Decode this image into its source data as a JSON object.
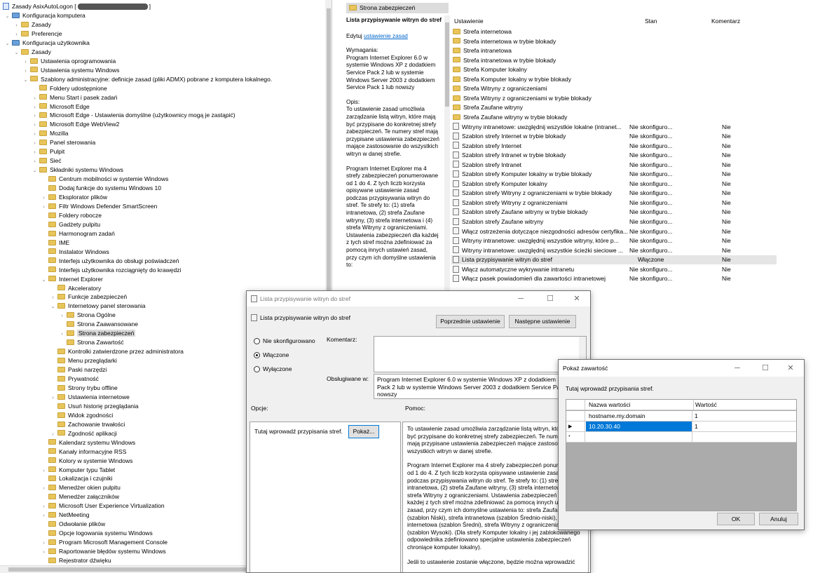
{
  "tree": {
    "root_label": "Zasady AsixAutoLogon [",
    "items": [
      {
        "label": "Konfiguracja komputera",
        "level": 0,
        "exp": "v",
        "icon": "computer"
      },
      {
        "label": "Zasady",
        "level": 1,
        "exp": ">",
        "icon": "folder"
      },
      {
        "label": "Preferencje",
        "level": 1,
        "exp": ">",
        "icon": "folder"
      },
      {
        "label": "Konfiguracja użytkownika",
        "level": 0,
        "exp": "v",
        "icon": "user"
      },
      {
        "label": "Zasady",
        "level": 1,
        "exp": "v",
        "icon": "folder"
      },
      {
        "label": "Ustawienia oprogramowania",
        "level": 2,
        "exp": ">",
        "icon": "folder"
      },
      {
        "label": "Ustawienia systemu Windows",
        "level": 2,
        "exp": ">",
        "icon": "folder"
      },
      {
        "label": "Szablony administracyjne: definicje zasad (pliki ADMX) pobrane z komputera lokalnego.",
        "level": 2,
        "exp": "v",
        "icon": "folder"
      },
      {
        "label": "Foldery udostępnione",
        "level": 3,
        "exp": "",
        "icon": "folder"
      },
      {
        "label": "Menu Start i pasek zadań",
        "level": 3,
        "exp": ">",
        "icon": "folder"
      },
      {
        "label": "Microsoft Edge",
        "level": 3,
        "exp": ">",
        "icon": "folder"
      },
      {
        "label": "Microsoft Edge - Ustawienia domyślne (użytkownicy mogą je zastąpić)",
        "level": 3,
        "exp": ">",
        "icon": "folder"
      },
      {
        "label": "Microsoft Edge WebView2",
        "level": 3,
        "exp": ">",
        "icon": "folder"
      },
      {
        "label": "Mozilla",
        "level": 3,
        "exp": ">",
        "icon": "folder"
      },
      {
        "label": "Panel sterowania",
        "level": 3,
        "exp": ">",
        "icon": "folder"
      },
      {
        "label": "Pulpit",
        "level": 3,
        "exp": ">",
        "icon": "folder"
      },
      {
        "label": "Sieć",
        "level": 3,
        "exp": ">",
        "icon": "folder"
      },
      {
        "label": "Składniki systemu Windows",
        "level": 3,
        "exp": "v",
        "icon": "folder"
      },
      {
        "label": "Centrum mobilności w systemie Windows",
        "level": 4,
        "exp": "",
        "icon": "folder"
      },
      {
        "label": "Dodaj funkcje do systemu Windows 10",
        "level": 4,
        "exp": "",
        "icon": "folder"
      },
      {
        "label": "Eksplorator plików",
        "level": 4,
        "exp": ">",
        "icon": "folder"
      },
      {
        "label": "Filtr Windows Defender SmartScreen",
        "level": 4,
        "exp": ">",
        "icon": "folder"
      },
      {
        "label": "Foldery robocze",
        "level": 4,
        "exp": "",
        "icon": "folder"
      },
      {
        "label": "Gadżety pulpitu",
        "level": 4,
        "exp": "",
        "icon": "folder"
      },
      {
        "label": "Harmonogram zadań",
        "level": 4,
        "exp": "",
        "icon": "folder"
      },
      {
        "label": "IME",
        "level": 4,
        "exp": "",
        "icon": "folder"
      },
      {
        "label": "Instalator Windows",
        "level": 4,
        "exp": "",
        "icon": "folder"
      },
      {
        "label": "Interfejs użytkownika do obsługi poświadczeń",
        "level": 4,
        "exp": "",
        "icon": "folder"
      },
      {
        "label": "Interfejs użytkownika rozciągnięty do krawędzi",
        "level": 4,
        "exp": "",
        "icon": "folder"
      },
      {
        "label": "Internet Explorer",
        "level": 4,
        "exp": "v",
        "icon": "folder"
      },
      {
        "label": "Akceleratory",
        "level": 5,
        "exp": "",
        "icon": "folder"
      },
      {
        "label": "Funkcje zabezpieczeń",
        "level": 5,
        "exp": ">",
        "icon": "folder"
      },
      {
        "label": "Internetowy panel sterowania",
        "level": 5,
        "exp": "v",
        "icon": "folder"
      },
      {
        "label": "Strona Ogólne",
        "level": 6,
        "exp": ">",
        "icon": "folder"
      },
      {
        "label": "Strona Zaawansowane",
        "level": 6,
        "exp": "",
        "icon": "folder"
      },
      {
        "label": "Strona zabezpieczeń",
        "level": 6,
        "exp": ">",
        "icon": "folder",
        "selected": true
      },
      {
        "label": "Strona Zawartość",
        "level": 6,
        "exp": "",
        "icon": "folder"
      },
      {
        "label": "Kontrolki zatwierdzone przez administratora",
        "level": 5,
        "exp": "",
        "icon": "folder"
      },
      {
        "label": "Menu przeglądarki",
        "level": 5,
        "exp": "",
        "icon": "folder"
      },
      {
        "label": "Paski narzędzi",
        "level": 5,
        "exp": "",
        "icon": "folder"
      },
      {
        "label": "Prywatność",
        "level": 5,
        "exp": "",
        "icon": "folder"
      },
      {
        "label": "Strony trybu offline",
        "level": 5,
        "exp": "",
        "icon": "folder"
      },
      {
        "label": "Ustawienia internetowe",
        "level": 5,
        "exp": ">",
        "icon": "folder"
      },
      {
        "label": "Usuń historię przeglądania",
        "level": 5,
        "exp": "",
        "icon": "folder"
      },
      {
        "label": "Widok zgodności",
        "level": 5,
        "exp": "",
        "icon": "folder"
      },
      {
        "label": "Zachowanie trwałości",
        "level": 5,
        "exp": "",
        "icon": "folder"
      },
      {
        "label": "Zgodność aplikacji",
        "level": 5,
        "exp": ">",
        "icon": "folder"
      },
      {
        "label": "Kalendarz systemu Windows",
        "level": 4,
        "exp": "",
        "icon": "folder"
      },
      {
        "label": "Kanały informacyjne RSS",
        "level": 4,
        "exp": "",
        "icon": "folder"
      },
      {
        "label": "Kolory w systemie Windows",
        "level": 4,
        "exp": "",
        "icon": "folder"
      },
      {
        "label": "Komputer typu Tablet",
        "level": 4,
        "exp": ">",
        "icon": "folder"
      },
      {
        "label": "Lokalizacja i czujniki",
        "level": 4,
        "exp": "",
        "icon": "folder"
      },
      {
        "label": "Menedżer okien pulpitu",
        "level": 4,
        "exp": ">",
        "icon": "folder"
      },
      {
        "label": "Menedżer załączników",
        "level": 4,
        "exp": "",
        "icon": "folder"
      },
      {
        "label": "Microsoft User Experience Virtualization",
        "level": 4,
        "exp": ">",
        "icon": "folder"
      },
      {
        "label": "NetMeeting",
        "level": 4,
        "exp": ">",
        "icon": "folder"
      },
      {
        "label": "Odwołanie plików",
        "level": 4,
        "exp": "",
        "icon": "folder"
      },
      {
        "label": "Opcje logowania systemu Windows",
        "level": 4,
        "exp": "",
        "icon": "folder"
      },
      {
        "label": "Program Microsoft Management Console",
        "level": 4,
        "exp": ">",
        "icon": "folder"
      },
      {
        "label": "Raportowanie błędów systemu Windows",
        "level": 4,
        "exp": ">",
        "icon": "folder"
      },
      {
        "label": "Rejestrator dźwięku",
        "level": 4,
        "exp": "",
        "icon": "folder"
      }
    ]
  },
  "detail": {
    "header": "Strona zabezpieczeń",
    "policy_title": "Lista przypisywanie witryn do stref",
    "edit_prefix": "Edytuj",
    "edit_link": "ustawienie zasad",
    "requirements_label": "Wymagania:",
    "requirements": "Program Internet Explorer 6.0 w systemie Windows XP z dodatkiem Service Pack 2 lub w systemie Windows Server 2003 z dodatkiem Service Pack 1 lub nowszy",
    "desc_label": "Opis:",
    "desc1": "To ustawienie zasad umożliwia zarządzanie listą witryn, które mają być przypisane do konkretnej strefy zabezpieczeń. Te numery stref mają przypisane ustawienia zabezpieczeń mające zastosowanie do wszystkich witryn w danej strefie.",
    "desc2": "Program Internet Explorer ma 4 strefy zabezpieczeń ponumerowane od 1 do 4. Z tych liczb korzysta opisywane ustawienie zasad podczas przypisywania witryn do stref. Te strefy to: (1) strefa intranetowa, (2) strefa Zaufane witryny, (3) strefa internetowa i (4) strefa Witryny z ograniczeniami. Ustawienia zabezpieczeń dla każdej z tych stref można zdefiniować za pomocą innych ustawień zasad, przy czym ich domyślne ustawienia to:"
  },
  "list": {
    "columns": {
      "setting": "Ustawienie",
      "state": "Stan",
      "comment": "Komentarz"
    },
    "folders": [
      "Strefa internetowa",
      "Strefa internetowa w trybie blokady",
      "Strefa intranetowa",
      "Strefa intranetowa w trybie blokady",
      "Strefa Komputer lokalny",
      "Strefa Komputer lokalny w trybie blokady",
      "Strefa Witryny z ograniczeniami",
      "Strefa Witryny z ograniczeniami w trybie blokady",
      "Strefa Zaufane witryny",
      "Strefa Zaufane witryny w trybie blokady"
    ],
    "settings": [
      {
        "name": "Witryny intranetowe: uwzględnij wszystkie lokalne (intranet...",
        "state": "Nie skonfiguro...",
        "comment": "Nie"
      },
      {
        "name": "Szablon strefy Internet w trybie blokady",
        "state": "Nie skonfiguro...",
        "comment": "Nie"
      },
      {
        "name": "Szablon strefy Internet",
        "state": "Nie skonfiguro...",
        "comment": "Nie"
      },
      {
        "name": "Szablon strefy Intranet w trybie blokady",
        "state": "Nie skonfiguro...",
        "comment": "Nie"
      },
      {
        "name": "Szablon strefy Intranet",
        "state": "Nie skonfiguro...",
        "comment": "Nie"
      },
      {
        "name": "Szablon strefy Komputer lokalny w trybie blokady",
        "state": "Nie skonfiguro...",
        "comment": "Nie"
      },
      {
        "name": "Szablon strefy Komputer lokalny",
        "state": "Nie skonfiguro...",
        "comment": "Nie"
      },
      {
        "name": "Szablon strefy Witryny z ograniczeniami w trybie blokady",
        "state": "Nie skonfiguro...",
        "comment": "Nie"
      },
      {
        "name": "Szablon strefy Witryny z ograniczeniami",
        "state": "Nie skonfiguro...",
        "comment": "Nie"
      },
      {
        "name": "Szablon strefy Zaufane witryny w trybie blokady",
        "state": "Nie skonfiguro...",
        "comment": "Nie"
      },
      {
        "name": "Szablon strefy Zaufane witryny",
        "state": "Nie skonfiguro...",
        "comment": "Nie"
      },
      {
        "name": "Włącz ostrzeżenia dotyczące niezgodności adresów certyfika...",
        "state": "Nie skonfiguro...",
        "comment": "Nie"
      },
      {
        "name": "Witryny intranetowe: uwzględnij wszystkie witryny, które p...",
        "state": "Nie skonfiguro...",
        "comment": "Nie"
      },
      {
        "name": "Witryny intranetowe: uwzględnij wszystkie ścieżki sieciowe ...",
        "state": "Nie skonfiguro...",
        "comment": "Nie"
      },
      {
        "name": "Lista przypisywanie witryn do stref",
        "state": "Włączone",
        "comment": "Nie",
        "selected": true
      },
      {
        "name": "Włącz automatyczne wykrywanie intranetu",
        "state": "Nie skonfiguro...",
        "comment": "Nie"
      },
      {
        "name": "Włącz pasek powiadomień dla zawartości intranetowej",
        "state": "Nie skonfiguro...",
        "comment": "Nie"
      }
    ]
  },
  "policy_dialog": {
    "window_title": "Lista przypisywanie witryn do stref",
    "heading": "Lista przypisywanie witryn do stref",
    "prev_button": "Poprzednie ustawienie",
    "next_button": "Następne ustawienie",
    "radio_not_configured": "Nie skonfigurowano",
    "radio_enabled": "Włączone",
    "radio_disabled": "Wyłączone",
    "comment_label": "Komentarz:",
    "supported_label": "Obsługiwane w:",
    "supported_text": "Program Internet Explorer 6.0 w systemie Windows XP z dodatkiem Service Pack 2 lub w systemie Windows Server 2003 z dodatkiem Service Pack 1 lub nowszy",
    "options_label": "Opcje:",
    "help_label": "Pomoc:",
    "options_text": "Tutaj wprowadź przypisania stref.",
    "show_button": "Pokaż...",
    "help_p1": "To ustawienie zasad umożliwia zarządzanie listą witryn, które mają być przypisane do konkretnej strefy zabezpieczeń. Te numery stref mają przypisane ustawienia zabezpieczeń mające zastosowanie do wszystkich witryn w danej strefie.",
    "help_p2": "Program Internet Explorer ma 4 strefy zabezpieczeń ponumerowane od 1 do 4. Z tych liczb korzysta opisywane ustawienie zasad podczas przypisywania witryn do stref. Te strefy to: (1) strefa intranetowa, (2) strefa Zaufane witryny, (3) strefa internetowa i (4) strefa Witryny z ograniczeniami. Ustawienia zabezpieczeń dla każdej z tych stref można zdefiniować za pomocą innych ustawień zasad, przy czym ich domyślne ustawienia to: strefa Zaufane witryny (szablon Niski), strefa intranetowa (szablon Średnio-niski), strefa internetowa (szablon Średni), strefa Witryny z ograniczeniami (szablon Wysoki). (Dla strefy Komputer lokalny i jej zablokowanego odpowiednika zdefiniowano specjalne ustawienia zabezpieczeń chroniące komputer lokalny).",
    "help_p3": "Jeśli to ustawienie zostanie włączone, będzie można wprowadzić"
  },
  "show_dialog": {
    "window_title": "Pokaż zawartość",
    "prompt": "Tutaj wprowadź przypisania stref.",
    "col_name": "Nazwa wartości",
    "col_value": "Wartość",
    "rows": [
      {
        "marker": "",
        "name": "hostname.my.domain",
        "value": "1"
      },
      {
        "marker": "▶",
        "name": "10.20.30.40",
        "value": "1",
        "selected": true
      },
      {
        "marker": "*",
        "name": "",
        "value": ""
      }
    ],
    "ok_button": "OK",
    "cancel_button": "Anuluj"
  }
}
